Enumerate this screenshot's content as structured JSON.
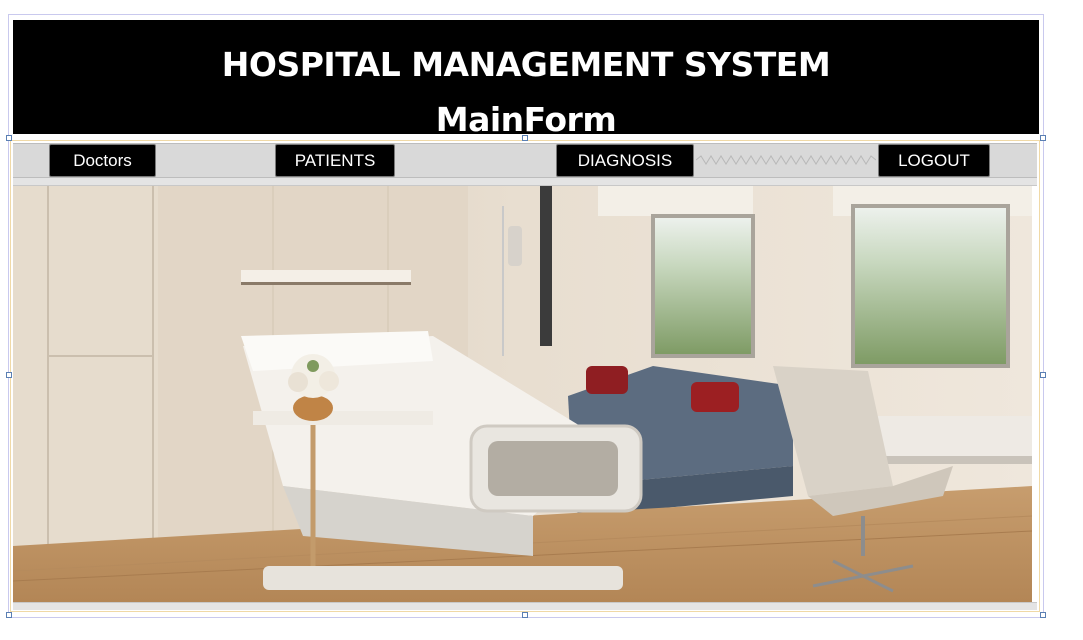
{
  "header": {
    "title": "HOSPITAL MANAGEMENT SYSTEM",
    "subtitle": "MainForm"
  },
  "menu": {
    "doctors_label": "Doctors",
    "patients_label": "PATIENTS",
    "diagnosis_label": "DIAGNOSIS",
    "logout_label": "LOGOUT"
  },
  "main": {
    "image_subject": "hospital-room"
  },
  "colors": {
    "header_bg": "#000000",
    "button_bg": "#000000",
    "button_text": "#ffffff",
    "strip_bg": "#d9d9d9"
  }
}
